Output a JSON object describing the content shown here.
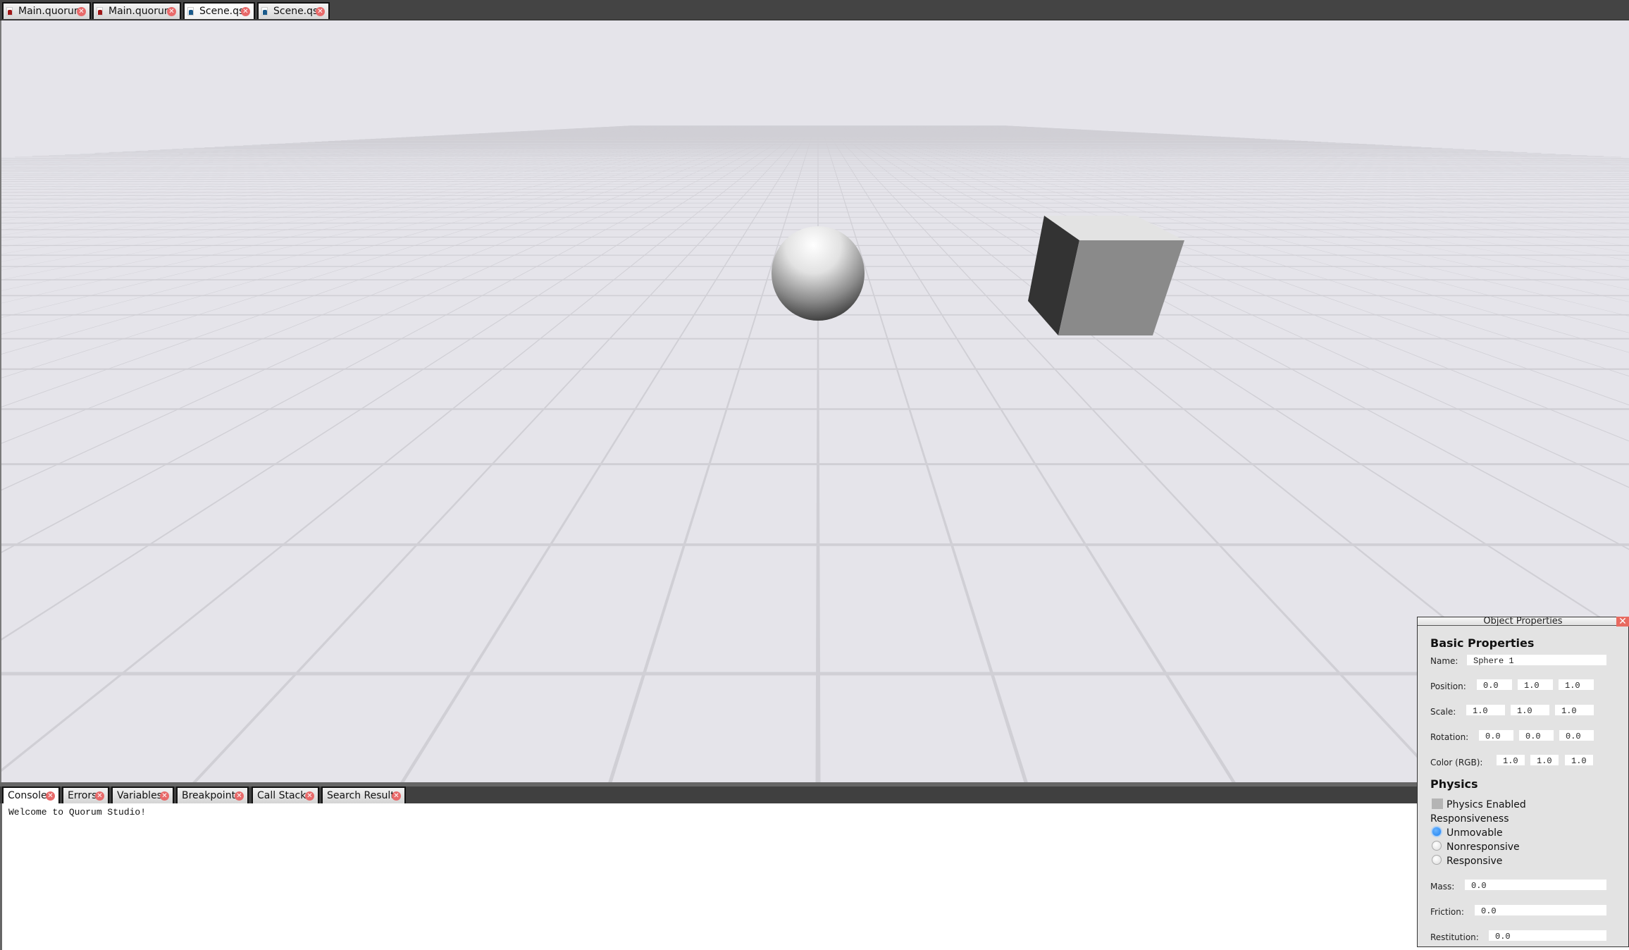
{
  "editor_tabs": [
    {
      "label": "Main.quorum",
      "icon": "quorum-file-icon",
      "active": false
    },
    {
      "label": "Main.quorum",
      "icon": "quorum-file-icon",
      "active": false
    },
    {
      "label": "Scene.qs",
      "icon": "scene-file-icon",
      "active": true
    },
    {
      "label": "Scene.qs",
      "icon": "scene-file-icon",
      "active": false
    }
  ],
  "close_glyph": "✕",
  "scene": {
    "objects": [
      {
        "type": "sphere",
        "name": "Sphere 1"
      },
      {
        "type": "cube"
      }
    ],
    "colors": {
      "background": "#e5e4ea",
      "grid": "#d0cfd5"
    }
  },
  "tool_tabs": [
    {
      "label": "Console",
      "active": true
    },
    {
      "label": "Errors",
      "active": false
    },
    {
      "label": "Variables",
      "active": false
    },
    {
      "label": "Breakpoints",
      "active": false
    },
    {
      "label": "Call Stack",
      "active": false
    },
    {
      "label": "Search Results",
      "active": false
    }
  ],
  "console": {
    "lines": [
      "Welcome to Quorum Studio!"
    ]
  },
  "properties": {
    "title": "Object Properties",
    "close_glyph": "✕",
    "basic_heading": "Basic Properties",
    "name_label": "Name:",
    "name_value": "Sphere 1",
    "position_label": "Position:",
    "position": [
      "0.0",
      "1.0",
      "1.0"
    ],
    "scale_label": "Scale:",
    "scale": [
      "1.0",
      "1.0",
      "1.0"
    ],
    "rotation_label": "Rotation:",
    "rotation": [
      "0.0",
      "0.0",
      "0.0"
    ],
    "color_label": "Color (RGB):",
    "color": [
      "1.0",
      "1.0",
      "1.0"
    ],
    "physics_heading": "Physics",
    "physics_enabled_label": "Physics Enabled",
    "physics_enabled": false,
    "responsiveness_label": "Responsiveness",
    "responsiveness_options": [
      "Unmovable",
      "Nonresponsive",
      "Responsive"
    ],
    "responsiveness_selected": "Unmovable",
    "mass_label": "Mass:",
    "mass": "0.0",
    "friction_label": "Friction:",
    "friction": "0.0",
    "restitution_label": "Restitution:",
    "restitution": "0.0",
    "accent_color": "#1e82f0",
    "close_color": "#e86a60"
  }
}
